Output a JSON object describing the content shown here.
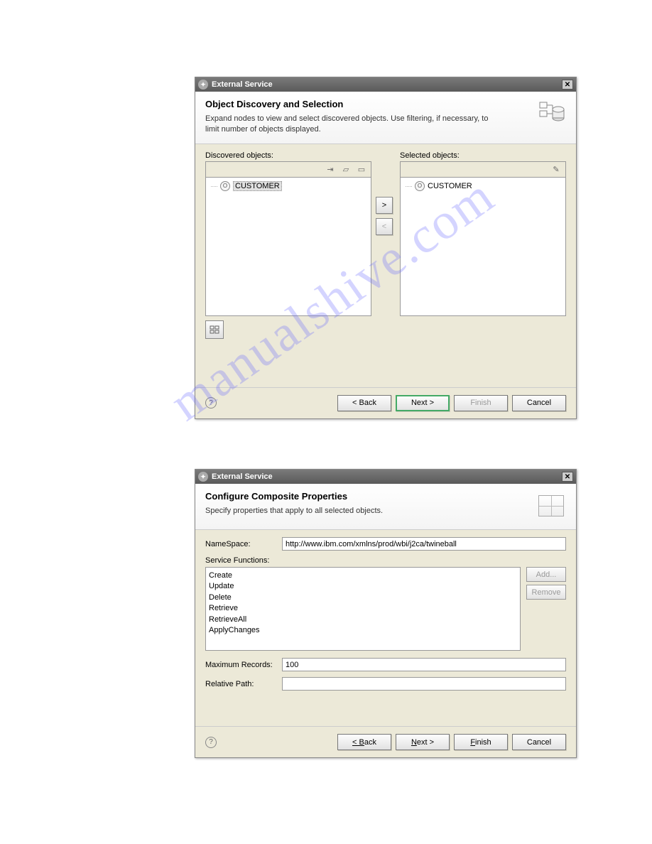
{
  "watermark": "manualshive.com",
  "dialog1": {
    "title": "External Service",
    "header_title": "Object Discovery and Selection",
    "header_desc": "Expand nodes to view and select discovered objects.  Use filtering, if necessary, to limit number of objects displayed.",
    "discovered_label": "Discovered objects:",
    "selected_label": "Selected objects:",
    "discovered_items": {
      "0": {
        "label": "CUSTOMER"
      }
    },
    "selected_items": {
      "0": {
        "label": "CUSTOMER"
      }
    },
    "btn_move_right": ">",
    "btn_move_left": "<",
    "btn_back": "< Back",
    "btn_next": "Next >",
    "btn_finish": "Finish",
    "btn_cancel": "Cancel"
  },
  "dialog2": {
    "title": "External Service",
    "header_title": "Configure Composite Properties",
    "header_desc": "Specify properties that apply to all selected objects.",
    "namespace_label": "NameSpace:",
    "namespace_value": "http://www.ibm.com/xmlns/prod/wbi/j2ca/twineball",
    "sfuncs_label": "Service Functions:",
    "sfuncs": {
      "0": "Create",
      "1": "Update",
      "2": "Delete",
      "3": "Retrieve",
      "4": "RetrieveAll",
      "5": "ApplyChanges"
    },
    "btn_add": "Add...",
    "btn_remove": "Remove",
    "maxrec_label": "Maximum Records:",
    "maxrec_value": "100",
    "relpath_label": "Relative Path:",
    "relpath_value": "",
    "btn_back": "< Back",
    "btn_next": "Next >",
    "btn_finish": "Finish",
    "btn_cancel": "Cancel"
  }
}
